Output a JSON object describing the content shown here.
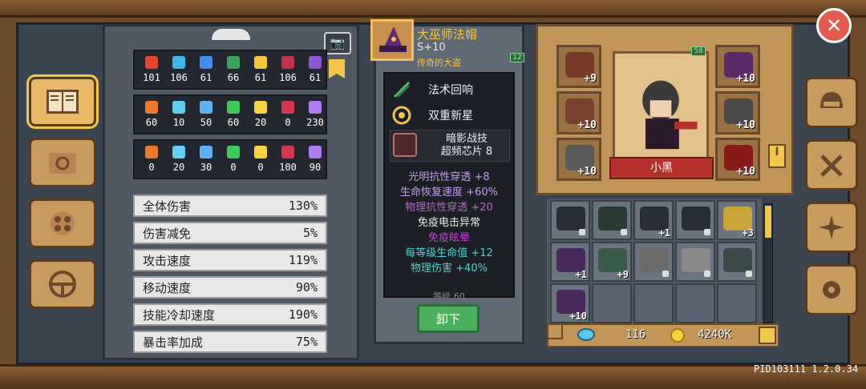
{
  "stats_grids": [
    {
      "items": [
        {
          "icon": "fire-resist-icon",
          "color": "#e2472d",
          "value": "101"
        },
        {
          "icon": "ice-resist-icon",
          "color": "#3fb6e8",
          "value": "106"
        },
        {
          "icon": "lightning-resist-icon",
          "color": "#3f8fe8",
          "value": "61"
        },
        {
          "icon": "poison-resist-icon",
          "color": "#3ea35a",
          "value": "66"
        },
        {
          "icon": "light-resist-icon",
          "color": "#f5c63a",
          "value": "61"
        },
        {
          "icon": "dark-resist-icon",
          "color": "#c0334a",
          "value": "106"
        },
        {
          "icon": "arcane-resist-icon",
          "color": "#8f55d9",
          "value": "61"
        }
      ]
    },
    {
      "items": [
        {
          "icon": "fire-icon",
          "color": "#f07a2a",
          "value": "60"
        },
        {
          "icon": "ice-icon",
          "color": "#5fd0f0",
          "value": "10"
        },
        {
          "icon": "lightning-icon",
          "color": "#5fb0f5",
          "value": "50"
        },
        {
          "icon": "poison-icon",
          "color": "#3ec95a",
          "value": "60"
        },
        {
          "icon": "light-icon",
          "color": "#f7d43f",
          "value": "20"
        },
        {
          "icon": "dark-icon",
          "color": "#d63750",
          "value": "0"
        },
        {
          "icon": "arcane-icon",
          "color": "#b07bf2",
          "value": "230"
        }
      ]
    },
    {
      "items": [
        {
          "icon": "fire-pen-icon",
          "color": "#f07a2a",
          "value": "0"
        },
        {
          "icon": "ice-pen-icon",
          "color": "#5fd0f0",
          "value": "20"
        },
        {
          "icon": "lightning-pen-icon",
          "color": "#5fb0f5",
          "value": "30"
        },
        {
          "icon": "poison-pen-icon",
          "color": "#3ec95a",
          "value": "0"
        },
        {
          "icon": "light-pen-icon",
          "color": "#f7d43f",
          "value": "0"
        },
        {
          "icon": "dark-pen-icon",
          "color": "#d63750",
          "value": "100"
        },
        {
          "icon": "arcane-pen-icon",
          "color": "#b07bf2",
          "value": "90"
        }
      ]
    }
  ],
  "stat_rows": [
    {
      "label": "全体伤害",
      "value": "130%"
    },
    {
      "label": "伤害减免",
      "value": "5%"
    },
    {
      "label": "攻击速度",
      "value": "119%"
    },
    {
      "label": "移动速度",
      "value": "90%"
    },
    {
      "label": "技能冷却速度",
      "value": "190%"
    },
    {
      "label": "暴击率加成",
      "value": "75%"
    }
  ],
  "item": {
    "name": "大巫师法帽",
    "grade": "S+10",
    "subtitle": "传奇的大盗",
    "level_badge": "12",
    "skills": [
      {
        "icon": "spell-echo-icon",
        "label": "法术回响"
      },
      {
        "icon": "double-nova-icon",
        "label": "双重新星"
      }
    ],
    "chip_line1": "暗影战技",
    "chip_line2": "超频芯片 8",
    "attributes": [
      {
        "text": "光明抗性穿透 +8",
        "color": "#c89cf2"
      },
      {
        "text": "生命恢复速度 +60%",
        "color": "#c89cf2"
      },
      {
        "text": "物理抗性穿透 +20",
        "color": "#b06cc0"
      },
      {
        "text": "免疫电击异常",
        "color": "#e8e8e8"
      },
      {
        "text": "免疫眩晕",
        "color": "#c03ed0"
      },
      {
        "text": "每等级生命值 +12",
        "color": "#4fd0d0"
      },
      {
        "text": "物理伤害 +40%",
        "color": "#4fd0d0"
      }
    ],
    "footer_cut": "等级 60",
    "unequip_label": "卸下"
  },
  "character": {
    "name": "小黑",
    "level_badge": "58",
    "side_tab": "I"
  },
  "equip_slots": [
    {
      "name": "amulet-slot",
      "plus": "+9",
      "color": "#7a3a2a"
    },
    {
      "name": "belt-slot",
      "plus": "+10",
      "color": "#7a4030"
    },
    {
      "name": "boots-slot",
      "plus": "+10",
      "color": "#5a5a5a"
    },
    {
      "name": "hat-slot",
      "plus": "+10",
      "color": "#5a2a6a"
    },
    {
      "name": "armor-slot",
      "plus": "+10",
      "color": "#4a4a4a"
    },
    {
      "name": "weapon-slot",
      "plus": "+10",
      "color": "#8a1a1a"
    }
  ],
  "inventory": [
    {
      "name": "inv-gun-1",
      "plus": "",
      "locked": true,
      "color": "#2a2f35"
    },
    {
      "name": "inv-gun-2",
      "plus": "",
      "locked": true,
      "color": "#2a3a35"
    },
    {
      "name": "inv-gun-3",
      "plus": "+1",
      "locked": false,
      "color": "#2a2f35"
    },
    {
      "name": "inv-gun-4",
      "plus": "",
      "locked": true,
      "color": "#2a2f35"
    },
    {
      "name": "inv-coins",
      "plus": "+3",
      "locked": false,
      "color": "#c9a43a"
    },
    {
      "name": "inv-hat",
      "plus": "+1",
      "locked": false,
      "color": "#4a2a5a"
    },
    {
      "name": "inv-amulet",
      "plus": "+9",
      "locked": false,
      "color": "#3a5a4a"
    },
    {
      "name": "inv-boots-1",
      "plus": "",
      "locked": true,
      "color": "#6a6a6a"
    },
    {
      "name": "inv-boots-2",
      "plus": "",
      "locked": true,
      "color": "#8a8a8a"
    },
    {
      "name": "inv-ring",
      "plus": "",
      "locked": true,
      "color": "#3a4a4a"
    },
    {
      "name": "inv-hat-2",
      "plus": "+10",
      "locked": false,
      "color": "#4a2a5a"
    }
  ],
  "currency": {
    "gems": "116",
    "coins": "4240K"
  },
  "version_text": "PID103111 1.2.0.34",
  "close_label": "✕",
  "camera_label": "📷"
}
